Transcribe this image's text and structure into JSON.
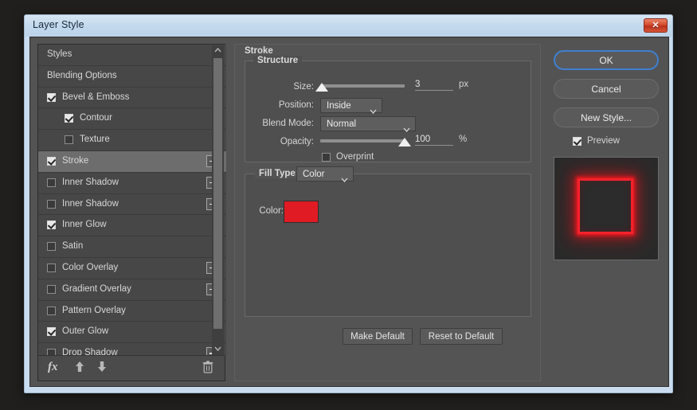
{
  "window": {
    "title": "Layer Style",
    "close_label": "✕"
  },
  "styles_panel": {
    "items": [
      {
        "label": "Styles",
        "level": 0,
        "has_checkbox": false,
        "checked": false,
        "selected": false,
        "has_plus": false
      },
      {
        "label": "Blending Options",
        "level": 0,
        "has_checkbox": false,
        "checked": false,
        "selected": false,
        "has_plus": false
      },
      {
        "label": "Bevel & Emboss",
        "level": 0,
        "has_checkbox": true,
        "checked": true,
        "selected": false,
        "has_plus": false
      },
      {
        "label": "Contour",
        "level": 1,
        "has_checkbox": true,
        "checked": true,
        "selected": false,
        "has_plus": false
      },
      {
        "label": "Texture",
        "level": 1,
        "has_checkbox": true,
        "checked": false,
        "selected": false,
        "has_plus": false
      },
      {
        "label": "Stroke",
        "level": 0,
        "has_checkbox": true,
        "checked": true,
        "selected": true,
        "has_plus": true
      },
      {
        "label": "Inner Shadow",
        "level": 0,
        "has_checkbox": true,
        "checked": false,
        "selected": false,
        "has_plus": true
      },
      {
        "label": "Inner Shadow",
        "level": 0,
        "has_checkbox": true,
        "checked": false,
        "selected": false,
        "has_plus": true
      },
      {
        "label": "Inner Glow",
        "level": 0,
        "has_checkbox": true,
        "checked": true,
        "selected": false,
        "has_plus": false
      },
      {
        "label": "Satin",
        "level": 0,
        "has_checkbox": true,
        "checked": false,
        "selected": false,
        "has_plus": false
      },
      {
        "label": "Color Overlay",
        "level": 0,
        "has_checkbox": true,
        "checked": false,
        "selected": false,
        "has_plus": true
      },
      {
        "label": "Gradient Overlay",
        "level": 0,
        "has_checkbox": true,
        "checked": false,
        "selected": false,
        "has_plus": true
      },
      {
        "label": "Pattern Overlay",
        "level": 0,
        "has_checkbox": true,
        "checked": false,
        "selected": false,
        "has_plus": false
      },
      {
        "label": "Outer Glow",
        "level": 0,
        "has_checkbox": true,
        "checked": true,
        "selected": false,
        "has_plus": false
      },
      {
        "label": "Drop Shadow",
        "level": 0,
        "has_checkbox": true,
        "checked": false,
        "selected": false,
        "has_plus": true
      }
    ],
    "toolbar": {
      "fx_label": "fx",
      "move_up_icon": "arrow-up-icon",
      "move_down_icon": "arrow-down-icon",
      "delete_icon": "trash-icon"
    }
  },
  "center": {
    "section_title": "Stroke",
    "structure": {
      "legend": "Structure",
      "size": {
        "label": "Size:",
        "value": "3",
        "unit": "px",
        "slider_percent": 2
      },
      "position": {
        "label": "Position:",
        "value": "Inside"
      },
      "blend_mode": {
        "label": "Blend Mode:",
        "value": "Normal"
      },
      "opacity": {
        "label": "Opacity:",
        "value": "100",
        "unit": "%",
        "slider_percent": 100
      },
      "overprint": {
        "label": "Overprint",
        "checked": false
      }
    },
    "fill": {
      "legend_label": "Fill Type:",
      "fill_type_value": "Color",
      "color_label": "Color:",
      "color_value": "#e01b24"
    },
    "buttons": {
      "make_default": "Make Default",
      "reset_to_default": "Reset to Default"
    }
  },
  "right": {
    "ok": "OK",
    "cancel": "Cancel",
    "new_style": "New Style...",
    "preview": {
      "label": "Preview",
      "checked": true
    },
    "thumbnail": {
      "name": "preview-thumbnail",
      "background_color": "#2a2a2a",
      "stroke_color": "#f4222c"
    }
  }
}
